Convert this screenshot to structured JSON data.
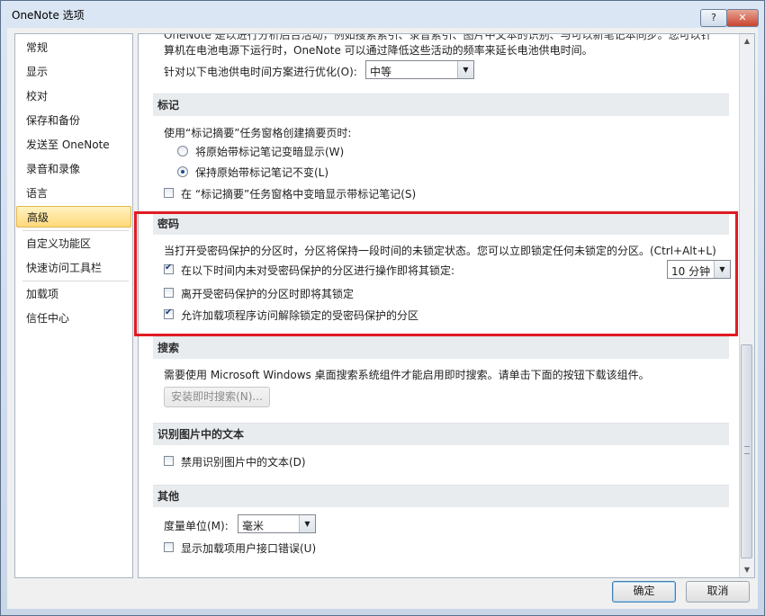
{
  "window": {
    "title": "OneNote 选项",
    "help_label": "?",
    "close_label": "✕"
  },
  "nav": {
    "items": [
      {
        "label": "常规"
      },
      {
        "label": "显示"
      },
      {
        "label": "校对"
      },
      {
        "label": "保存和备份"
      },
      {
        "label": "发送至 OneNote"
      },
      {
        "label": "录音和录像"
      },
      {
        "label": "语言"
      },
      {
        "label": "高级",
        "selected": true
      },
      {
        "label": "自定义功能区"
      },
      {
        "label": "快速访问工具栏"
      },
      {
        "label": "加载项"
      },
      {
        "label": "信任中心"
      }
    ]
  },
  "battery": {
    "line1": "OneNote 是以进行分析后台活动，例如搜索索引、录音索引、图片中文本的识别、与可以新笔记本同步。您可以针",
    "line2": "算机在电池电源下运行时，OneNote 可以通过降低这些活动的频率来延长电池供电时间。",
    "optimize_label": "针对以下电池供电时间方案进行优化(O):",
    "optimize_value": "中等"
  },
  "tags": {
    "header": "标记",
    "intro": "使用“标记摘要”任务窗格创建摘要页时:",
    "radio1": "将原始带标记笔记变暗显示(W)",
    "radio2": "保持原始带标记笔记不变(L)",
    "checkbox": "在 “标记摘要”任务窗格中变暗显示带标记笔记(S)"
  },
  "password": {
    "header": "密码",
    "desc": "当打开受密码保护的分区时，分区将保持一段时间的未锁定状态。您可以立即锁定任何未锁定的分区。(Ctrl+Alt+L)",
    "opt1": "在以下时间内未对受密码保护的分区进行操作即将其锁定:",
    "opt1_value": "10 分钟",
    "opt2": "离开受密码保护的分区时即将其锁定",
    "opt3": "允许加载项程序访问解除锁定的受密码保护的分区"
  },
  "search": {
    "header": "搜索",
    "desc": "需要使用 Microsoft Windows 桌面搜索系统组件才能启用即时搜索。请单击下面的按钮下载该组件。",
    "install_button": "安装即时搜索(N)..."
  },
  "ocr": {
    "header": "识别图片中的文本",
    "checkbox": "禁用识别图片中的文本(D)"
  },
  "other": {
    "header": "其他",
    "unit_label": "度量单位(M):",
    "unit_value": "毫米",
    "addin_errors": "显示加载项用户接口错误(U)"
  },
  "footer": {
    "ok": "确定",
    "cancel": "取消"
  }
}
